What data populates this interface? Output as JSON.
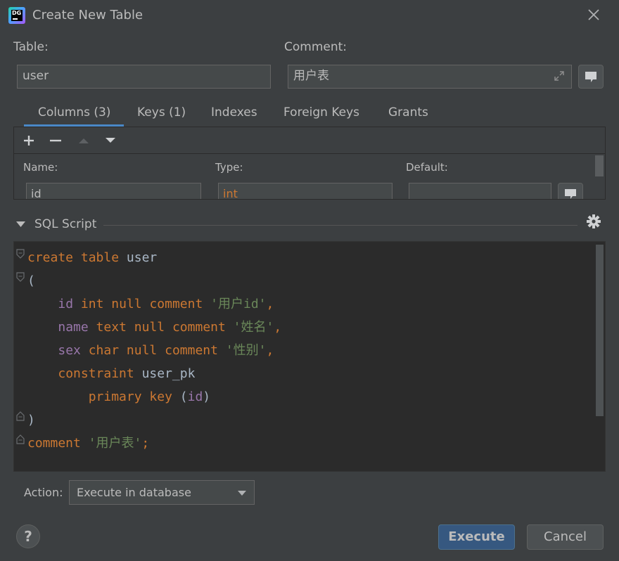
{
  "window": {
    "title": "Create New Table",
    "app_icon_text": "DG"
  },
  "form": {
    "table_label": "Table:",
    "table_value": "user",
    "comment_label": "Comment:",
    "comment_value": "用户表"
  },
  "tabs": [
    {
      "label": "Columns (3)",
      "active": true
    },
    {
      "label": "Keys (1)",
      "active": false
    },
    {
      "label": "Indexes",
      "active": false
    },
    {
      "label": "Foreign Keys",
      "active": false
    },
    {
      "label": "Grants",
      "active": false
    }
  ],
  "columns_panel": {
    "name_label": "Name:",
    "type_label": "Type:",
    "default_label": "Default:",
    "name_value": "id",
    "type_value": "int",
    "default_value": ""
  },
  "sql_section": {
    "label": "SQL Script"
  },
  "sql_lines": [
    "create table user",
    "(",
    "    id int null comment '用户id',",
    "    name text null comment '姓名',",
    "    sex char null comment '性别',",
    "    constraint user_pk",
    "        primary key (id)",
    ")",
    "comment '用户表';"
  ],
  "action": {
    "label": "Action:",
    "value": "Execute in database"
  },
  "buttons": {
    "help": "?",
    "execute": "Execute",
    "cancel": "Cancel"
  },
  "colors": {
    "accent": "#4a88c7",
    "keyword": "#cc7832",
    "identifier": "#9876aa",
    "string": "#6a8759",
    "primary_button": "#365880"
  }
}
